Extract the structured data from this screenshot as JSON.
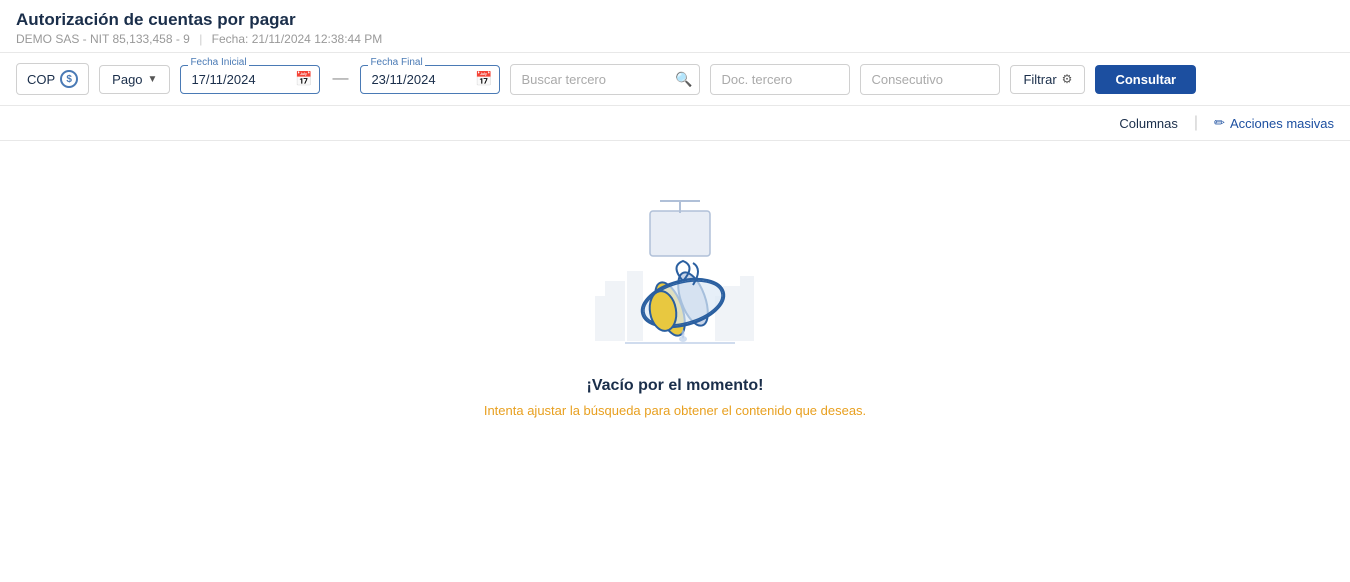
{
  "header": {
    "title": "Autorización de cuentas por pagar",
    "company": "DEMO SAS - NIT 85,133,458 - 9",
    "date_label": "Fecha: 21/11/2024 12:38:44 PM"
  },
  "toolbar": {
    "currency_label": "COP",
    "currency_icon": "$",
    "pago_label": "Pago",
    "fecha_inicial_label": "Fecha Inicial",
    "fecha_inicial_value": "17/11/2024",
    "fecha_final_label": "Fecha Final",
    "fecha_final_value": "23/11/2024",
    "buscar_placeholder": "Buscar tercero",
    "doc_placeholder": "Doc. tercero",
    "consecutivo_placeholder": "Consecutivo",
    "filtrar_label": "Filtrar",
    "consultar_label": "Consultar"
  },
  "action_bar": {
    "columns_label": "Columnas",
    "acciones_label": "Acciones masivas"
  },
  "empty_state": {
    "title": "¡Vacío por el momento!",
    "subtitle": "Intenta ajustar la búsqueda para obtener el contenido que deseas."
  }
}
